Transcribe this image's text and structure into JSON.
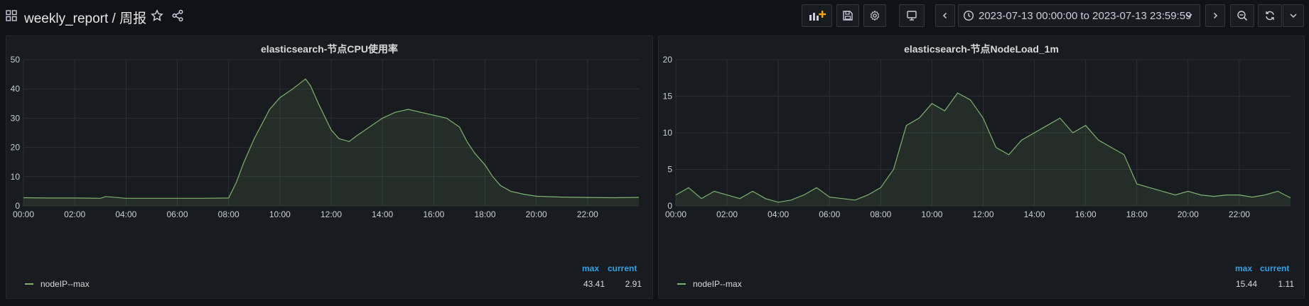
{
  "dashboard": {
    "title": "weekly_report / 周报"
  },
  "toolbar": {
    "add_panel_icon": "add-panel-icon",
    "save_icon": "save-icon",
    "settings_icon": "gear-icon",
    "tv_icon": "monitor-icon",
    "time_range": "2023-07-13 00:00:00 to 2023-07-13 23:59:59"
  },
  "colors": {
    "series": "#7eb26d",
    "legend_header": "#33a2e5",
    "background": "#111217",
    "panel": "#181b1f"
  },
  "panels": [
    {
      "title": "elasticsearch-节点CPU使用率",
      "legend": {
        "headers": [
          "max",
          "current"
        ],
        "series": "nodeIP--max",
        "max": "43.41",
        "current": "2.91"
      },
      "chart_data": {
        "type": "area",
        "title": "elasticsearch-节点CPU使用率",
        "ylim": [
          0,
          50
        ],
        "yticks": [
          "0",
          "10",
          "20",
          "30",
          "40",
          "50"
        ],
        "xticks": [
          "00:00",
          "02:00",
          "04:00",
          "06:00",
          "08:00",
          "10:00",
          "12:00",
          "14:00",
          "16:00",
          "18:00",
          "20:00",
          "22:00"
        ],
        "x_hours": [
          0,
          1,
          2,
          3,
          3.2,
          4,
          5,
          6,
          7,
          8,
          8.3,
          8.6,
          9,
          9.3,
          9.6,
          10,
          10.5,
          11,
          11.2,
          11.5,
          12,
          12.3,
          12.7,
          13,
          13.5,
          14,
          14.5,
          15,
          15.5,
          16,
          16.5,
          17,
          17.3,
          17.6,
          18,
          18.3,
          18.6,
          19,
          19.5,
          20,
          21,
          22,
          23,
          24
        ],
        "values": [
          2.8,
          2.7,
          2.7,
          2.6,
          3.2,
          2.6,
          2.6,
          2.6,
          2.6,
          2.7,
          8,
          15,
          23,
          28,
          33,
          37,
          40,
          43.41,
          41,
          35,
          26,
          23,
          22,
          24,
          27,
          30,
          32,
          33,
          32,
          31,
          30,
          27,
          22,
          18,
          14,
          10,
          7,
          5,
          4,
          3.3,
          3,
          2.9,
          2.8,
          2.91
        ],
        "series": [
          {
            "name": "nodeIP--max"
          }
        ]
      }
    },
    {
      "title": "elasticsearch-节点NodeLoad_1m",
      "legend": {
        "headers": [
          "max",
          "current"
        ],
        "series": "nodeIP--max",
        "max": "15.44",
        "current": "1.11"
      },
      "chart_data": {
        "type": "area",
        "title": "elasticsearch-节点NodeLoad_1m",
        "ylim": [
          0,
          20
        ],
        "yticks": [
          "0",
          "5",
          "10",
          "15",
          "20"
        ],
        "xticks": [
          "00:00",
          "02:00",
          "04:00",
          "06:00",
          "08:00",
          "10:00",
          "12:00",
          "14:00",
          "16:00",
          "18:00",
          "20:00",
          "22:00"
        ],
        "x_hours": [
          0,
          0.5,
          1,
          1.5,
          2,
          2.5,
          3,
          3.5,
          4,
          4.5,
          5,
          5.5,
          6,
          6.5,
          7,
          7.5,
          8,
          8.5,
          9,
          9.5,
          10,
          10.5,
          11,
          11.5,
          12,
          12.5,
          13,
          13.5,
          14,
          14.5,
          15,
          15.5,
          16,
          16.5,
          17,
          17.5,
          18,
          18.5,
          19,
          19.5,
          20,
          20.5,
          21,
          21.5,
          22,
          22.5,
          23,
          23.5,
          24
        ],
        "values": [
          1.5,
          2.5,
          1,
          2,
          1.5,
          1,
          2,
          1,
          0.5,
          0.8,
          1.5,
          2.5,
          1.2,
          1,
          0.8,
          1.5,
          2.5,
          5,
          11,
          12,
          14,
          13,
          15.44,
          14.5,
          12,
          8,
          7,
          9,
          10,
          11,
          12,
          10,
          11,
          9,
          8,
          7,
          3,
          2.5,
          2,
          1.5,
          2,
          1.5,
          1.3,
          1.5,
          1.5,
          1.2,
          1.5,
          2,
          1.11
        ],
        "series": [
          {
            "name": "nodeIP--max"
          }
        ]
      }
    }
  ]
}
